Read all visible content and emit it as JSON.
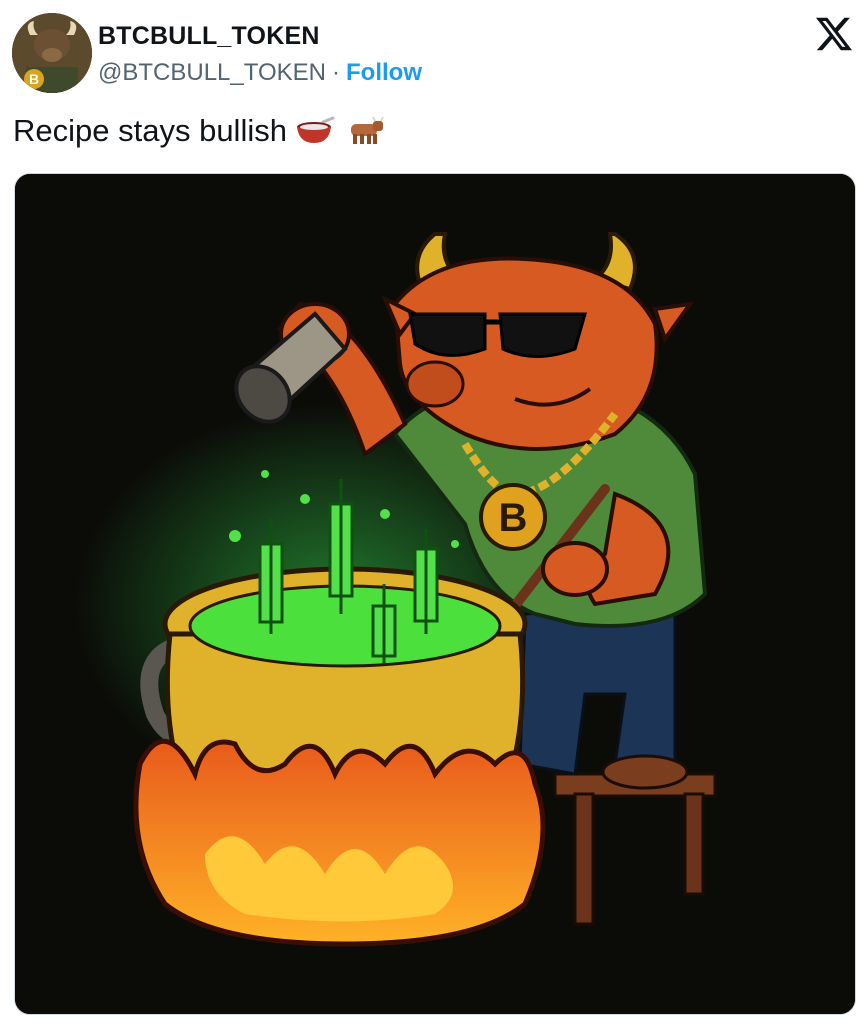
{
  "author": {
    "display_name": "BTCBULL_TOKEN",
    "handle": "@BTCBULL_TOKEN",
    "separator": "·",
    "follow_label": "Follow",
    "avatar_icon": "bull-mascot-avatar"
  },
  "tweet": {
    "text": "Recipe stays bullish",
    "emojis": [
      "bowl-with-spoon-emoji",
      "ox-emoji"
    ]
  },
  "media": {
    "description_icon": "bull-cooking-cauldron-image",
    "coin_symbol": "B"
  },
  "colors": {
    "follow": "#1d9bf0",
    "text": "#0f1419",
    "secondary": "#536471"
  },
  "icons": {
    "platform_logo": "x-logo-icon"
  }
}
